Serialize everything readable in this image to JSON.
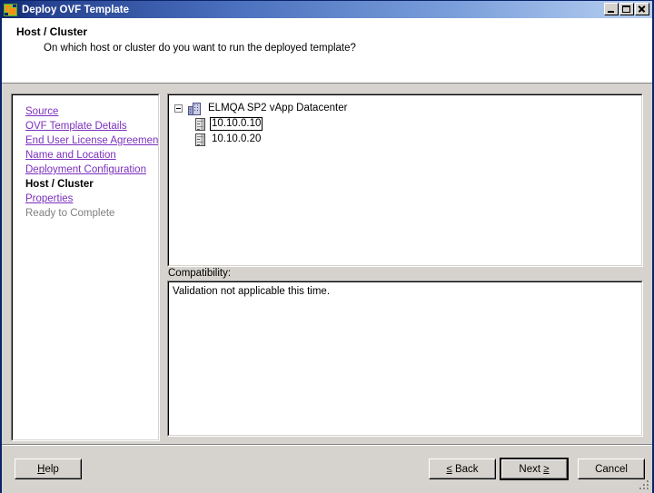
{
  "window": {
    "title": "Deploy OVF Template",
    "icon": "ovf-template-icon",
    "controls": {
      "minimize": "Minimize",
      "maximize": "Maximize",
      "close": "Close"
    }
  },
  "header": {
    "title": "Host / Cluster",
    "subtitle": "On which host or cluster do you want to run the deployed template?"
  },
  "steps": [
    {
      "label": "Source",
      "state": "link"
    },
    {
      "label": "OVF Template Details",
      "state": "link"
    },
    {
      "label": "End User License Agreement",
      "state": "link"
    },
    {
      "label": "Name and Location",
      "state": "link"
    },
    {
      "label": "Deployment Configuration",
      "state": "link"
    },
    {
      "label": "Host / Cluster",
      "state": "current"
    },
    {
      "label": "Properties",
      "state": "link"
    },
    {
      "label": "Ready to Complete",
      "state": "disabled"
    }
  ],
  "tree": {
    "root": {
      "label": "ELMQA SP2 vApp Datacenter",
      "icon": "datacenter-icon",
      "expanded": true
    },
    "children": [
      {
        "label": "10.10.0.10",
        "icon": "host-icon",
        "focused": true
      },
      {
        "label": "10.10.0.20",
        "icon": "host-icon",
        "focused": false
      }
    ]
  },
  "compatibility": {
    "label": "Compatibility:",
    "message": "Validation not applicable this time."
  },
  "footer": {
    "help": "Help",
    "back": "≤ Back",
    "back_prefix": "≤",
    "back_text": " Back",
    "next_text": "Next ",
    "next_suffix": "≥",
    "next": "Next ≥",
    "cancel": "Cancel",
    "help_accel": "H"
  },
  "colors": {
    "title_bar_dark": "#0a246a",
    "title_bar_light": "#b6cdf0",
    "face": "#d6d3ce",
    "link": "#7b2fbe",
    "disabled_text": "#808080",
    "text": "#000000",
    "panel_bg": "#ffffff"
  }
}
